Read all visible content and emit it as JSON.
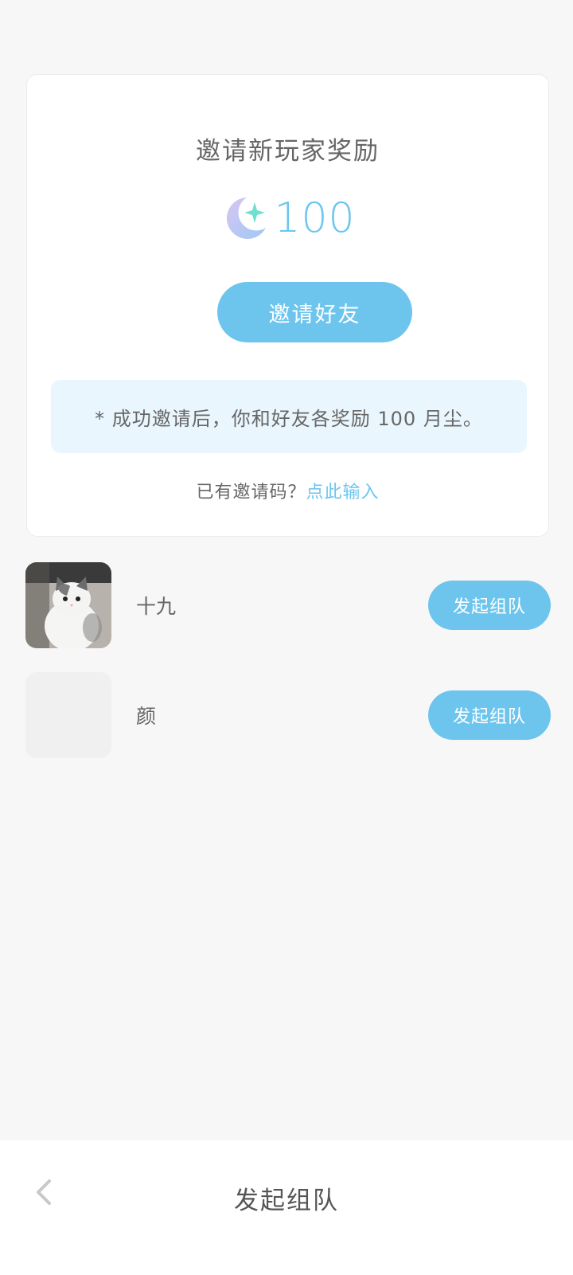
{
  "invite_card": {
    "title": "邀请新玩家奖励",
    "reward_icon": "moon-star-icon",
    "reward_amount": "100",
    "invite_button": "邀请好友",
    "note": "* 成功邀请后，你和好友各奖励 100 月尘。",
    "code_prompt": "已有邀请码？",
    "code_link": "点此输入"
  },
  "friends": [
    {
      "name": "十九",
      "avatar": "cat-photo",
      "button": "发起组队"
    },
    {
      "name": "颜",
      "avatar": "empty-placeholder",
      "button": "发起组队"
    }
  ],
  "bottom_bar": {
    "back_icon": "chevron-left-icon",
    "title": "发起组队"
  },
  "colors": {
    "accent": "#6dc5ee",
    "background": "#f7f7f7",
    "note_background": "#eaf6fd"
  }
}
